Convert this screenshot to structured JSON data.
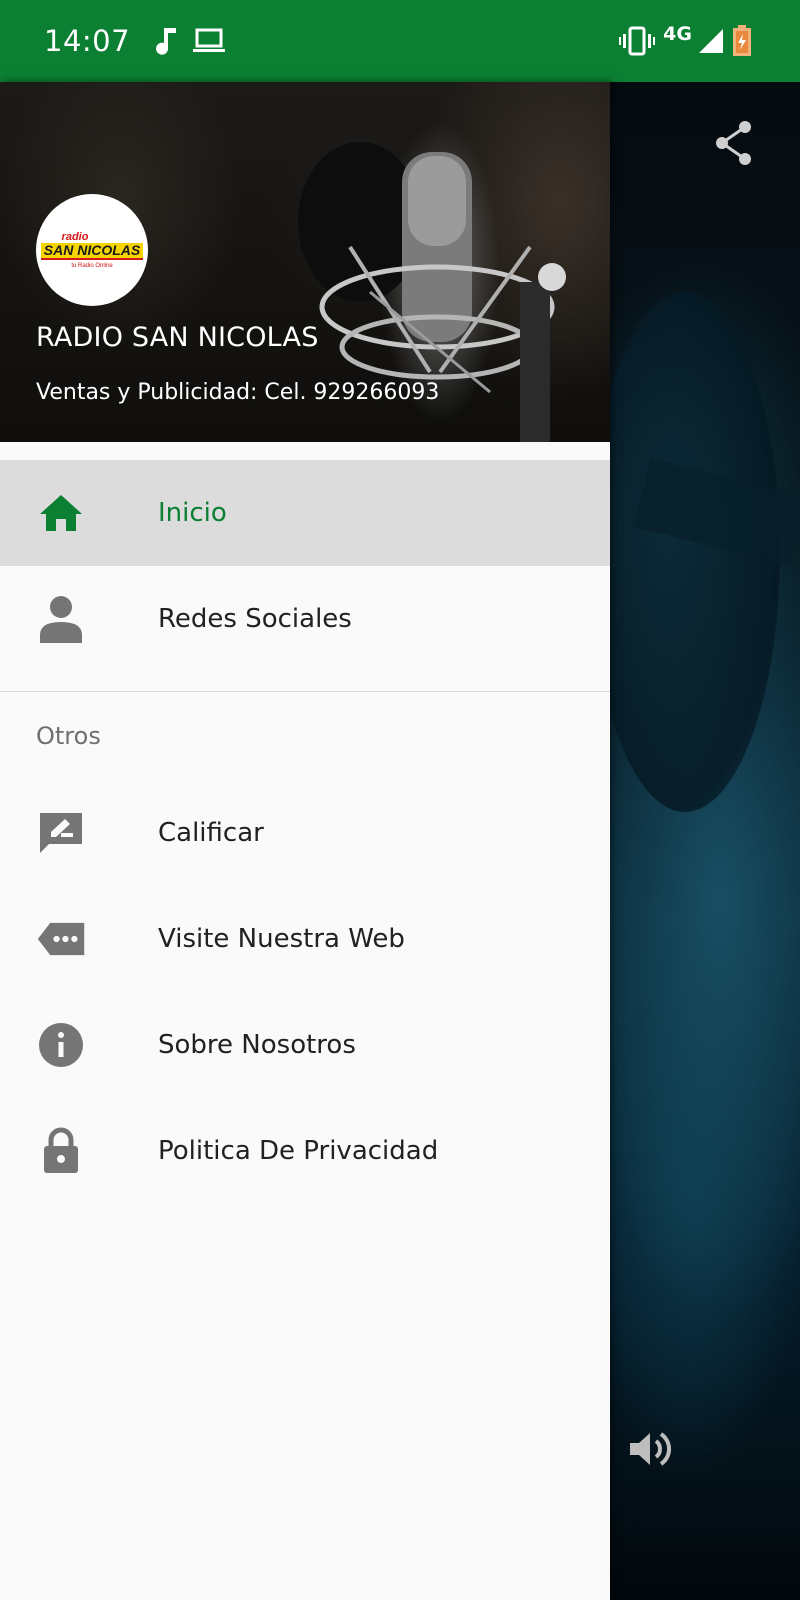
{
  "status_bar": {
    "time": "14:07",
    "network": "4G",
    "icons": [
      "music-note-icon",
      "laptop-icon",
      "vibrate-icon",
      "signal-icon",
      "battery-charging-icon"
    ],
    "background": "#0b7f32"
  },
  "drawer": {
    "header": {
      "title": "RADIO SAN NICOLAS",
      "subtitle": "Ventas y Publicidad: Cel. 929266093",
      "logo": {
        "top_word": "radio",
        "main_word": "SAN NICOLAS",
        "tagline": "tu Radio Online"
      }
    },
    "primary_items": [
      {
        "label": "Inicio",
        "icon": "home-icon",
        "active": true
      },
      {
        "label": "Redes Sociales",
        "icon": "person-icon",
        "active": false
      }
    ],
    "section_label": "Otros",
    "other_items": [
      {
        "label": "Calificar",
        "icon": "rate-review-icon"
      },
      {
        "label": "Visite Nuestra Web",
        "icon": "web-label-icon"
      },
      {
        "label": "Sobre Nosotros",
        "icon": "info-icon"
      },
      {
        "label": "Politica De Privacidad",
        "icon": "lock-icon"
      }
    ]
  },
  "background_controls": {
    "share": "share-icon",
    "volume": "volume-icon"
  },
  "colors": {
    "accent": "#0b7f32",
    "active_item_bg": "#dcdcdc",
    "icon_grey": "#757575",
    "drawer_bg": "#fafafa"
  }
}
